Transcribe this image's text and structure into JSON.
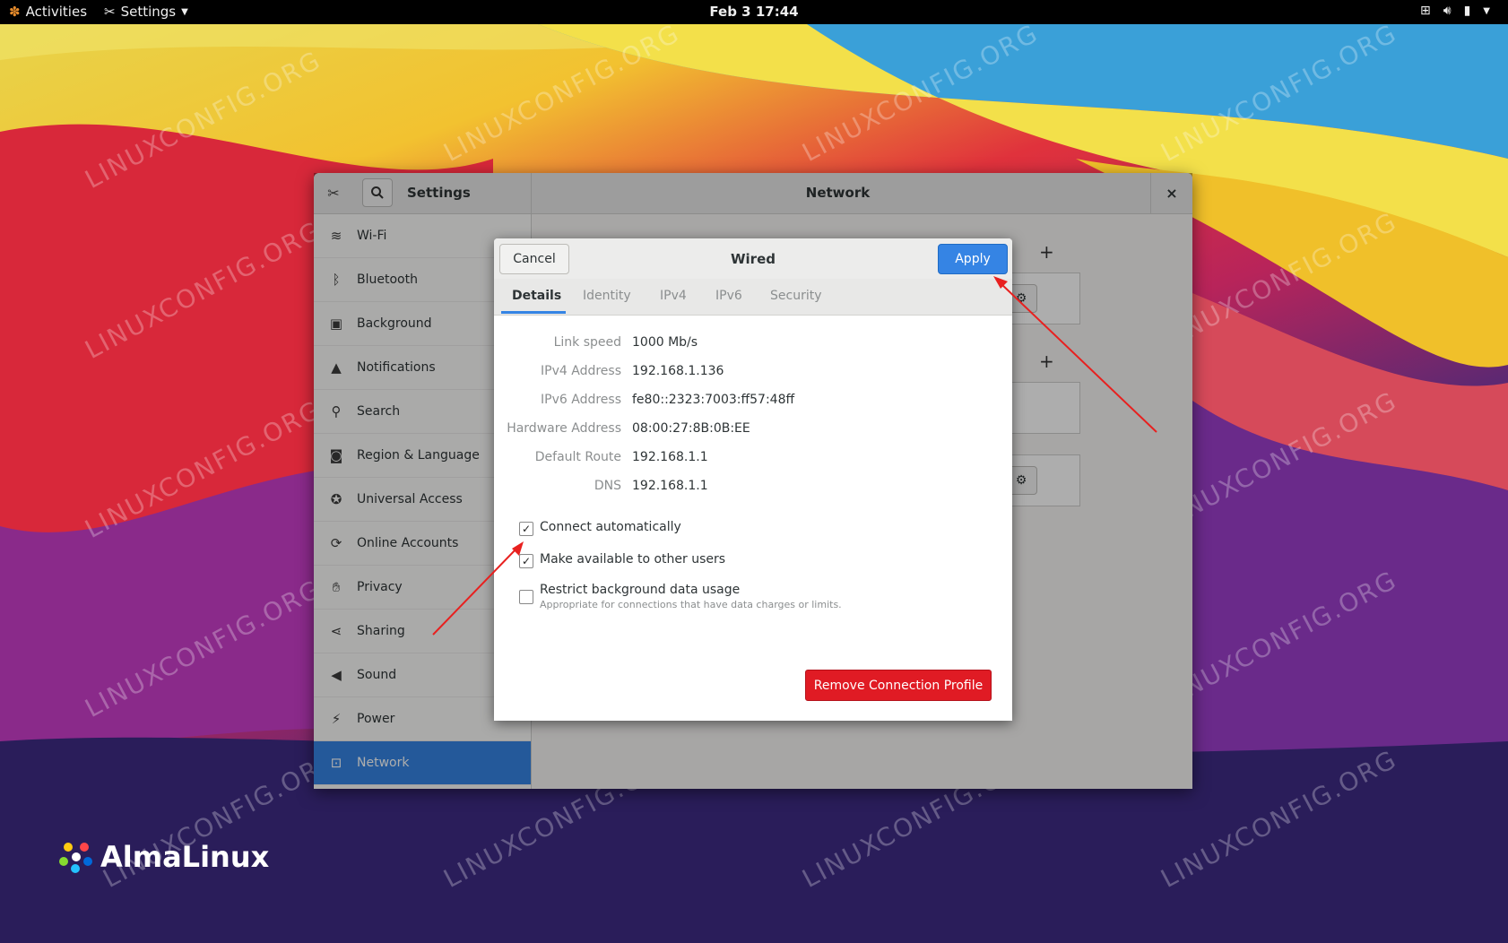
{
  "topbar": {
    "activities": "Activities",
    "app_menu": "Settings",
    "clock": "Feb 3  17:44",
    "tray_icons": [
      "network-icon",
      "volume-icon",
      "battery-icon",
      "chevron-down-icon"
    ]
  },
  "desktop": {
    "watermark": "LINUXCONFIG.ORG",
    "brand": "AlmaLinux"
  },
  "settings": {
    "title": "Settings",
    "panel_title": "Network",
    "close_label": "×",
    "sidebar": [
      {
        "label": "Wi-Fi",
        "icon": "wifi-icon"
      },
      {
        "label": "Bluetooth",
        "icon": "bluetooth-icon"
      },
      {
        "label": "Background",
        "icon": "background-icon"
      },
      {
        "label": "Notifications",
        "icon": "bell-icon"
      },
      {
        "label": "Search",
        "icon": "search-icon"
      },
      {
        "label": "Region & Language",
        "icon": "camera-icon"
      },
      {
        "label": "Universal Access",
        "icon": "accessibility-icon"
      },
      {
        "label": "Online Accounts",
        "icon": "accounts-icon"
      },
      {
        "label": "Privacy",
        "icon": "hand-icon"
      },
      {
        "label": "Sharing",
        "icon": "share-icon"
      },
      {
        "label": "Sound",
        "icon": "speaker-icon"
      },
      {
        "label": "Power",
        "icon": "power-icon"
      },
      {
        "label": "Network",
        "icon": "network-icon",
        "active": true
      }
    ],
    "add_symbol": "+"
  },
  "dialog": {
    "title": "Wired",
    "cancel": "Cancel",
    "apply": "Apply",
    "tabs": [
      {
        "label": "Details",
        "active": true
      },
      {
        "label": "Identity"
      },
      {
        "label": "IPv4"
      },
      {
        "label": "IPv6"
      },
      {
        "label": "Security"
      }
    ],
    "details": [
      {
        "key": "Link speed",
        "value": "1000 Mb/s"
      },
      {
        "key": "IPv4 Address",
        "value": "192.168.1.136"
      },
      {
        "key": "IPv6 Address",
        "value": "fe80::2323:7003:ff57:48ff"
      },
      {
        "key": "Hardware Address",
        "value": "08:00:27:8B:0B:EE"
      },
      {
        "key": "Default Route",
        "value": "192.168.1.1"
      },
      {
        "key": "DNS",
        "value": "192.168.1.1"
      }
    ],
    "options": [
      {
        "label": "Connect automatically",
        "checked": true
      },
      {
        "label": "Make available to other users",
        "checked": true
      },
      {
        "label": "Restrict background data usage",
        "checked": false,
        "sub": "Appropriate for connections that have data charges or limits."
      }
    ],
    "remove": "Remove Connection Profile"
  },
  "colors": {
    "accent": "#3584e4",
    "destructive": "#e01b24",
    "annotation_arrow": "#e8201f"
  }
}
